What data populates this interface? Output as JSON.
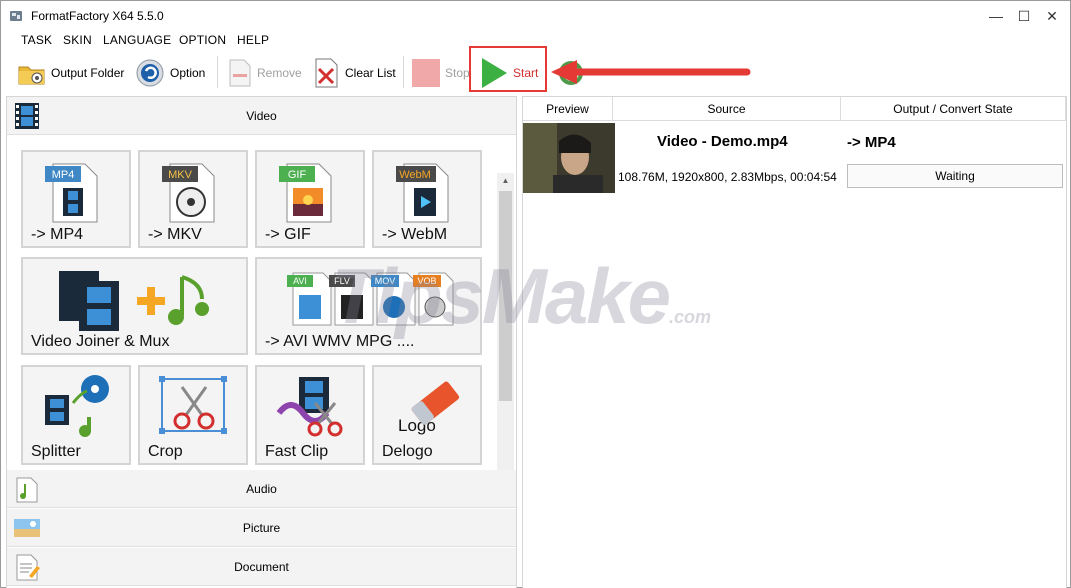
{
  "window": {
    "title": "FormatFactory X64 5.5.0"
  },
  "menu": [
    "TASK",
    "SKIN",
    "LANGUAGE",
    "OPTION",
    "HELP"
  ],
  "toolbar": {
    "output_folder": "Output Folder",
    "option": "Option",
    "remove": "Remove",
    "clear_list": "Clear List",
    "stop": "Stop",
    "start": "Start"
  },
  "categories": {
    "video": "Video",
    "audio": "Audio",
    "picture": "Picture",
    "document": "Document"
  },
  "tiles": [
    {
      "label": "-> MP4",
      "badge": "MP4"
    },
    {
      "label": "-> MKV",
      "badge": "MKV"
    },
    {
      "label": "-> GIF",
      "badge": "GIF"
    },
    {
      "label": "-> WebM",
      "badge": "WebM"
    },
    {
      "label": "Video Joiner & Mux"
    },
    {
      "label": "-> AVI WMV MPG ....",
      "badges": [
        "AVI",
        "FLV",
        "MOV",
        "VOB"
      ]
    },
    {
      "label": "Splitter"
    },
    {
      "label": "Crop"
    },
    {
      "label": "Fast Clip"
    },
    {
      "label": "Delogo",
      "logo_text": "Logo"
    }
  ],
  "list": {
    "columns": [
      "Preview",
      "Source",
      "Output / Convert State"
    ],
    "tasks": [
      {
        "source_title": "Video - Demo.mp4",
        "meta": "108.76M, 1920x800, 2.83Mbps, 00:04:54",
        "output_format": "-> MP4",
        "state": "Waiting"
      }
    ]
  },
  "watermark": {
    "brand": "TipsMake",
    "suffix": ".com"
  },
  "colors": {
    "highlight": "#e53935",
    "start_green": "#3cb043"
  }
}
